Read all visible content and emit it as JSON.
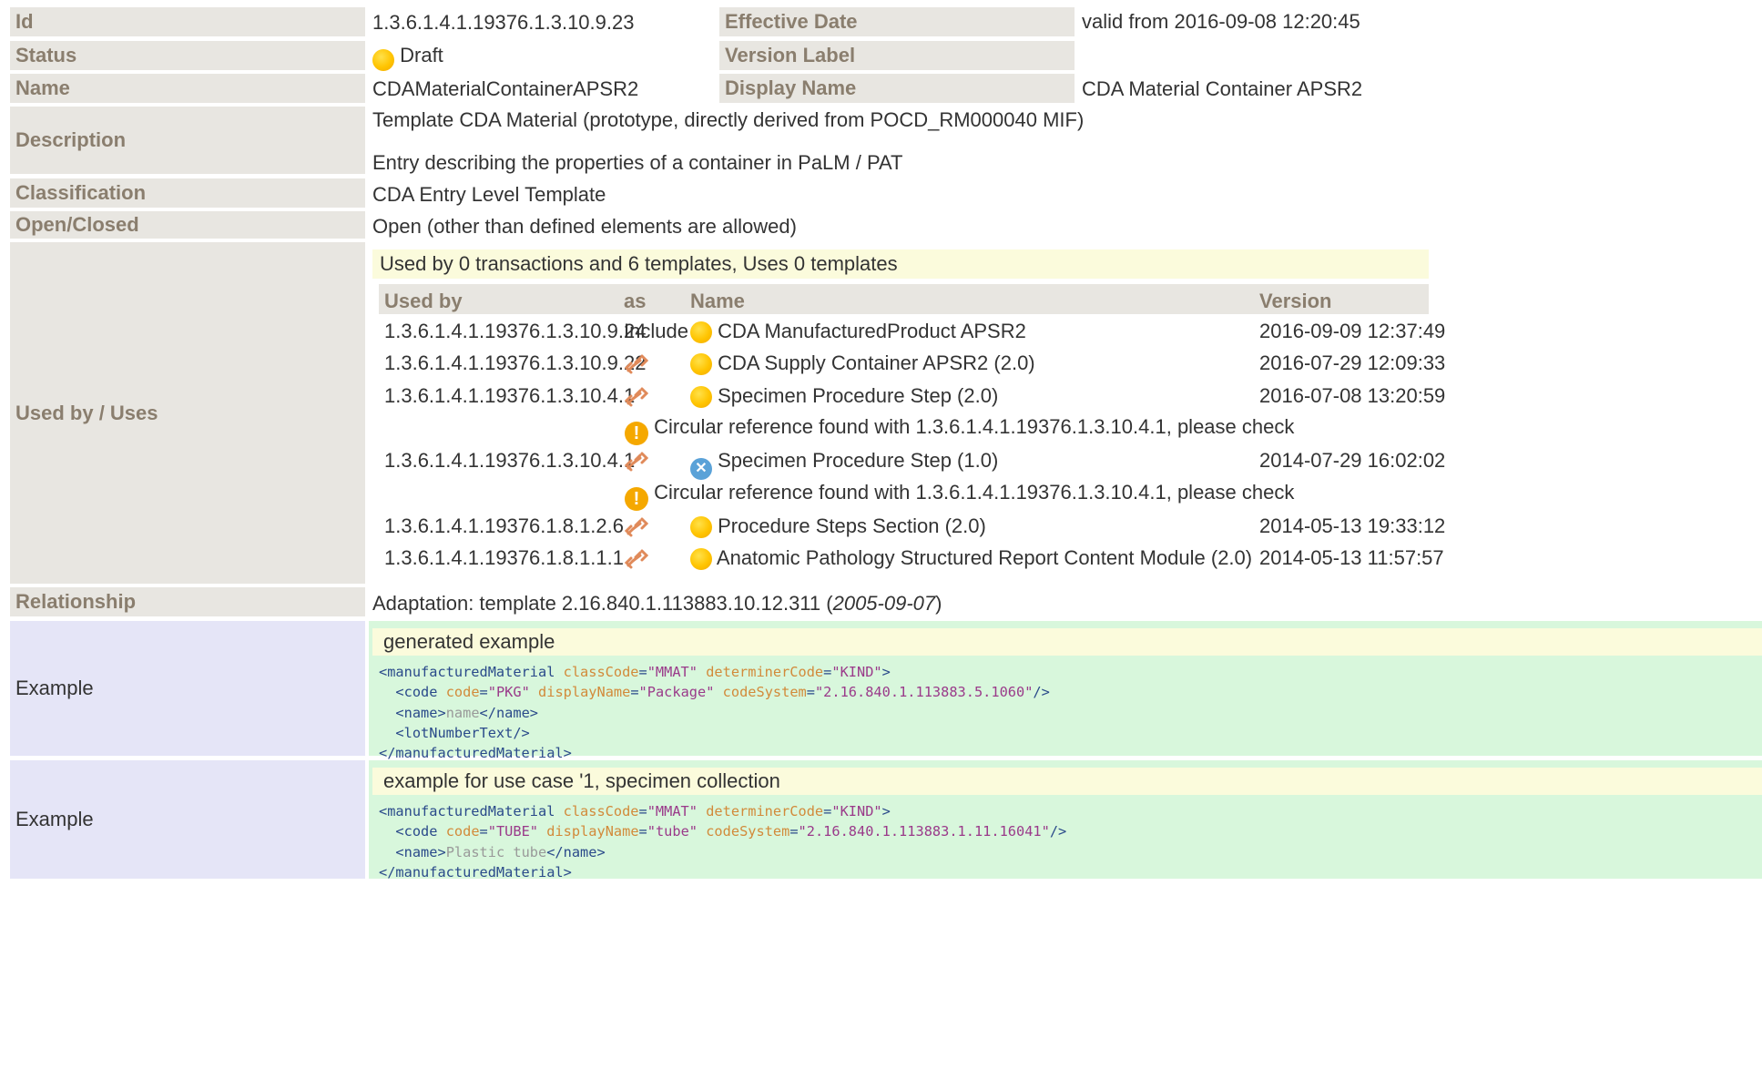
{
  "colors": {
    "label_bg": "#e8e6e1",
    "label_text": "#8a7e6e",
    "example_label_bg": "#e5e5f7",
    "example_bg": "#d8f7dc",
    "notice_bg": "#fbfbdc",
    "draft_status": "#ffc400",
    "cancelled_status": "#5aa2d8",
    "warning": "#f5a800"
  },
  "labels": {
    "id": "Id",
    "status": "Status",
    "name": "Name",
    "description": "Description",
    "classification": "Classification",
    "open_closed": "Open/Closed",
    "used_by_uses": "Used by / Uses",
    "relationship": "Relationship",
    "example": "Example",
    "effective_date": "Effective Date",
    "version_label": "Version Label",
    "display_name": "Display Name"
  },
  "values": {
    "id": "1.3.6.1.4.1.19376.1.3.10.9.23",
    "status": "Draft",
    "name": "CDAMaterialContainerAPSR2",
    "effective_date": "valid from 2016-09-08 12:20:45",
    "version_label": "",
    "display_name": "CDA Material Container APSR2",
    "description_line1": "Template CDA Material (prototype, directly derived from POCD_RM000040 MIF)",
    "description_line2": "Entry describing the properties of a container in PaLM / PAT",
    "classification": "CDA Entry Level Template",
    "open_closed": "Open (other than defined elements are allowed)",
    "relationship_prefix": "Adaptation: template 2.16.840.1.113883.10.12.311 (",
    "relationship_date": "2005-09-07",
    "relationship_suffix": ")"
  },
  "usage": {
    "summary": "Used by 0 transactions and 6 templates, Uses 0 templates",
    "headers": {
      "used_by": "Used by",
      "as": "as",
      "name": "Name",
      "version": "Version"
    },
    "rows": [
      {
        "id": "1.3.6.1.4.1.19376.1.3.10.9.24",
        "as": "Include",
        "status_icon": "draft-status-icon",
        "name": "CDA ManufacturedProduct APSR2",
        "version": "2016-09-09 12:37:49"
      },
      {
        "id": "1.3.6.1.4.1.19376.1.3.10.9.22",
        "as": "link-icon",
        "status_icon": "draft-status-icon",
        "name": "CDA Supply Container APSR2 (2.0)",
        "version": "2016-07-29 12:09:33"
      },
      {
        "id": "1.3.6.1.4.1.19376.1.3.10.4.1",
        "as": "link-icon",
        "status_icon": "draft-status-icon",
        "name": "Specimen Procedure Step (2.0)",
        "version": "2016-07-08 13:20:59"
      },
      {
        "id": "1.3.6.1.4.1.19376.1.3.10.4.1",
        "as": "link-icon",
        "status_icon": "cancelled-status-icon",
        "name": "Specimen Procedure Step (1.0)",
        "version": "2014-07-29 16:02:02"
      },
      {
        "id": "1.3.6.1.4.1.19376.1.8.1.2.6",
        "as": "link-icon",
        "status_icon": "draft-status-icon",
        "name": "Procedure Steps Section (2.0)",
        "version": "2014-05-13 19:33:12"
      },
      {
        "id": "1.3.6.1.4.1.19376.1.8.1.1.1",
        "as": "link-icon",
        "status_icon": "draft-status-icon",
        "name": "Anatomic Pathology Structured Report Content Module (2.0)",
        "version": "2014-05-13 11:57:57"
      }
    ],
    "warning_1": "Circular reference found with 1.3.6.1.4.1.19376.1.3.10.4.1, please check",
    "warning_2": "Circular reference found with 1.3.6.1.4.1.19376.1.3.10.4.1, please check",
    "warning_glyph": "!",
    "cancel_glyph": "✕"
  },
  "examples": [
    {
      "title": "generated example",
      "lines": [
        {
          "tag_open": "<manufacturedMaterial ",
          "a1": "classCode",
          "eq1": "=",
          "v1": "\"MMAT\"",
          "a2": " determinerCode",
          "eq2": "=",
          "v2": "\"KIND\"",
          "end": ">"
        },
        {
          "tag_open": "  <code ",
          "a1": "code",
          "eq1": "=",
          "v1": "\"PKG\"",
          "a2": " displayName",
          "eq2": "=",
          "v2": "\"Package\"",
          "a3": " codeSystem",
          "eq3": "=",
          "v3": "\"2.16.840.1.113883.5.1060\"",
          "end": "/>"
        },
        {
          "open": "  <name>",
          "text": "name",
          "close": "</name>"
        },
        {
          "plain": "  <lotNumberText/>"
        },
        {
          "plain": "</manufacturedMaterial>"
        }
      ]
    },
    {
      "title": "example for use case '1, specimen collection",
      "lines": [
        {
          "tag_open": "<manufacturedMaterial ",
          "a1": "classCode",
          "eq1": "=",
          "v1": "\"MMAT\"",
          "a2": " determinerCode",
          "eq2": "=",
          "v2": "\"KIND\"",
          "end": ">"
        },
        {
          "tag_open": "  <code ",
          "a1": "code",
          "eq1": "=",
          "v1": "\"TUBE\"",
          "a2": " displayName",
          "eq2": "=",
          "v2": "\"tube\"",
          "a3": " codeSystem",
          "eq3": "=",
          "v3": "\"2.16.840.1.113883.1.11.16041\"",
          "end": "/>"
        },
        {
          "open": "  <name>",
          "text": "Plastic tube",
          "close": "</name>"
        },
        {
          "plain": "</manufacturedMaterial>"
        }
      ]
    }
  ]
}
